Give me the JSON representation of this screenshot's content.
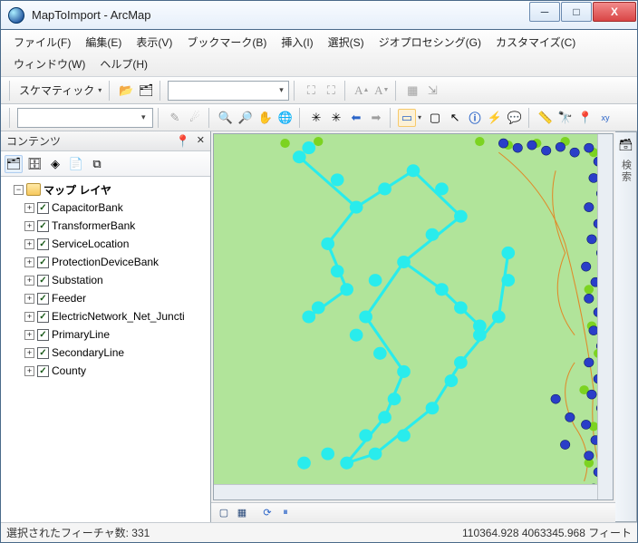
{
  "window": {
    "title": "MapToImport - ArcMap"
  },
  "menu": {
    "file": "ファイル(F)",
    "edit": "編集(E)",
    "view": "表示(V)",
    "bookmarks": "ブックマーク(B)",
    "insert": "挿入(I)",
    "select": "選択(S)",
    "geoprocessing": "ジオプロセシング(G)",
    "customize": "カスタマイズ(C)",
    "windows": "ウィンドウ(W)",
    "help": "ヘルプ(H)"
  },
  "schematic_label": "スケマティック",
  "toc": {
    "title": "コンテンツ",
    "dataframe_label": "マップ レイヤ",
    "layers": [
      "CapacitorBank",
      "TransformerBank",
      "ServiceLocation",
      "ProtectionDeviceBank",
      "Substation",
      "Feeder",
      "ElectricNetwork_Net_Juncti",
      "PrimaryLine",
      "SecondaryLine",
      "County"
    ]
  },
  "status": {
    "selected_label": "選択されたフィーチャ数: 331",
    "coords": "110364.928 4063345.968 フィート"
  },
  "right_tab": {
    "label": "検索"
  }
}
